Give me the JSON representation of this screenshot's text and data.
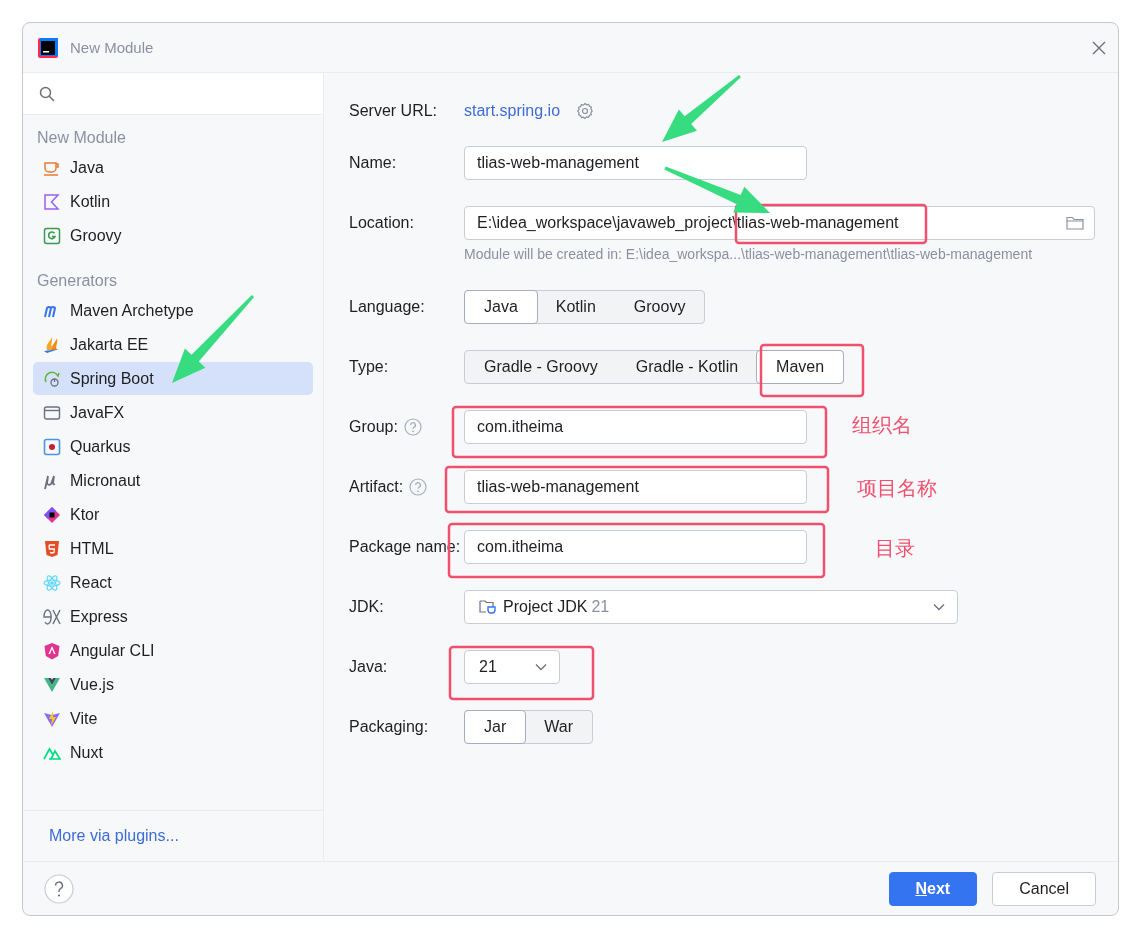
{
  "window": {
    "title": "New Module"
  },
  "sidebar": {
    "sections": [
      {
        "title": "New Module",
        "items": [
          {
            "label": "Java",
            "kind": "java",
            "selected": false
          },
          {
            "label": "Kotlin",
            "kind": "kotlin",
            "selected": false
          },
          {
            "label": "Groovy",
            "kind": "groovy",
            "selected": false
          }
        ]
      },
      {
        "title": "Generators",
        "items": [
          {
            "label": "Maven Archetype",
            "kind": "maven",
            "selected": false
          },
          {
            "label": "Jakarta EE",
            "kind": "jakarta",
            "selected": false
          },
          {
            "label": "Spring Boot",
            "kind": "spring",
            "selected": true
          },
          {
            "label": "JavaFX",
            "kind": "javafx",
            "selected": false
          },
          {
            "label": "Quarkus",
            "kind": "quarkus",
            "selected": false
          },
          {
            "label": "Micronaut",
            "kind": "micronaut",
            "selected": false
          },
          {
            "label": "Ktor",
            "kind": "ktor",
            "selected": false
          },
          {
            "label": "HTML",
            "kind": "html",
            "selected": false
          },
          {
            "label": "React",
            "kind": "react",
            "selected": false
          },
          {
            "label": "Express",
            "kind": "express",
            "selected": false
          },
          {
            "label": "Angular CLI",
            "kind": "angular",
            "selected": false
          },
          {
            "label": "Vue.js",
            "kind": "vue",
            "selected": false
          },
          {
            "label": "Vite",
            "kind": "vite",
            "selected": false
          },
          {
            "label": "Nuxt",
            "kind": "nuxt",
            "selected": false
          }
        ]
      }
    ],
    "more_link": "More via plugins..."
  },
  "form": [
    {
      "kind": "link",
      "label": "Server URL:",
      "value": "start.spring.io"
    },
    {
      "kind": "text",
      "label": "Name:",
      "value": "tlias-web-management",
      "help": false
    },
    {
      "kind": "path",
      "label": "Location:",
      "value": "E:\\idea_workspace\\javaweb_project\\tlias-web-management",
      "hint": "Module will be created in: E:\\idea_workspa...\\tlias-web-management\\tlias-web-management"
    },
    {
      "kind": "segmented",
      "label": "Language:",
      "options": [
        {
          "label": "Java",
          "selected": true
        },
        {
          "label": "Kotlin",
          "selected": false
        },
        {
          "label": "Groovy",
          "selected": false
        }
      ]
    },
    {
      "kind": "segmented",
      "label": "Type:",
      "options": [
        {
          "label": "Gradle - Groovy",
          "selected": false
        },
        {
          "label": "Gradle - Kotlin",
          "selected": false
        },
        {
          "label": "Maven",
          "selected": true
        }
      ]
    },
    {
      "kind": "text",
      "label": "Group:",
      "value": "com.itheima",
      "help": true
    },
    {
      "kind": "text",
      "label": "Artifact:",
      "value": "tlias-web-management",
      "help": true
    },
    {
      "kind": "text",
      "label": "Package name:",
      "value": "com.itheima",
      "help": false
    },
    {
      "kind": "jdk",
      "label": "JDK:",
      "value": "Project JDK",
      "version": "21"
    },
    {
      "kind": "dropdown",
      "label": "Java:",
      "value": "21"
    },
    {
      "kind": "segmented",
      "label": "Packaging:",
      "options": [
        {
          "label": "Jar",
          "selected": true
        },
        {
          "label": "War",
          "selected": false
        }
      ]
    }
  ],
  "annotations": [
    {
      "text": "组织名"
    },
    {
      "text": "项目名称"
    },
    {
      "text": "目录"
    }
  ],
  "buttons": [
    {
      "label": "Next",
      "kind": "primary"
    },
    {
      "label": "Cancel",
      "kind": "secondary"
    }
  ]
}
